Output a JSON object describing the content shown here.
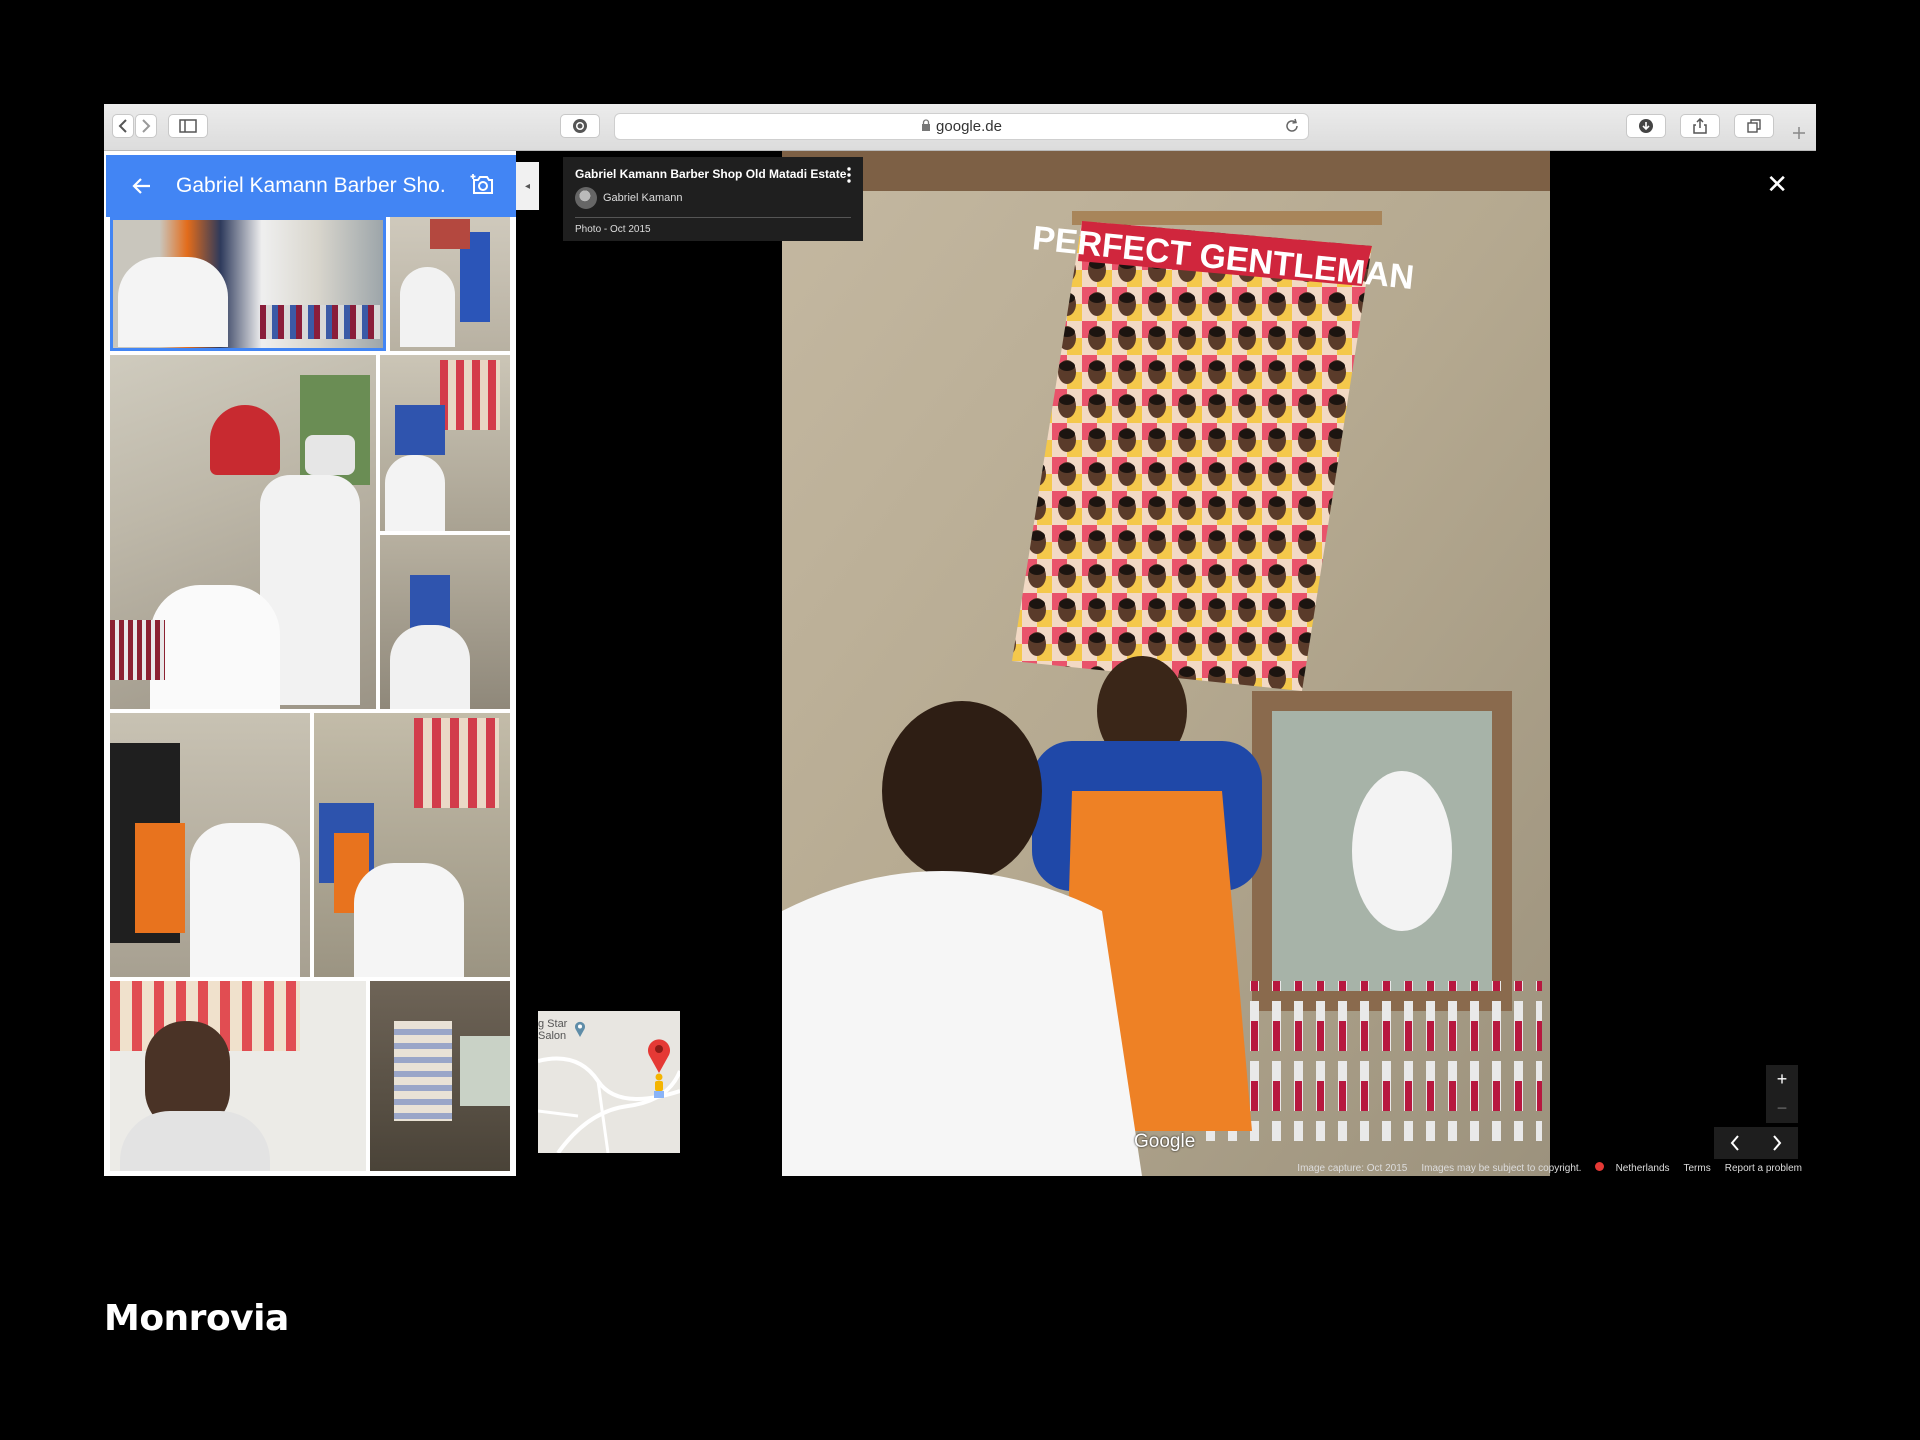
{
  "browser": {
    "url": "google.de"
  },
  "panel": {
    "title": "Gabriel Kamann Barber Sho...",
    "collapse_glyph": "◂"
  },
  "photo": {
    "title": "Gabriel Kamann Barber Shop Old Matadi Estate",
    "author": "Gabriel Kamann",
    "date": "Photo - Oct 2015",
    "poster_text": "PERFECT GENTLEMAN"
  },
  "map": {
    "place_label_1": "g Star",
    "place_label_2": "Salon"
  },
  "viewer": {
    "google_logo": "Google",
    "close_glyph": "✕",
    "zoom_in": "+",
    "zoom_out": "−",
    "footer": {
      "capture": "Image capture: Oct 2015",
      "copyright": "Images may be subject to copyright.",
      "country": "Netherlands",
      "terms": "Terms",
      "report": "Report a problem"
    }
  },
  "caption": "Monrovia",
  "icons": [
    "back-icon",
    "forward-icon",
    "sidebar-icon",
    "shield-icon",
    "lock-icon",
    "reload-icon",
    "download-icon",
    "share-icon",
    "tabs-icon",
    "new-tab-icon",
    "back-arrow-icon",
    "add-photo-icon",
    "kebab-icon",
    "close-icon",
    "map-pin-icon",
    "pegman-icon",
    "chevron-left-icon",
    "chevron-right-icon"
  ]
}
